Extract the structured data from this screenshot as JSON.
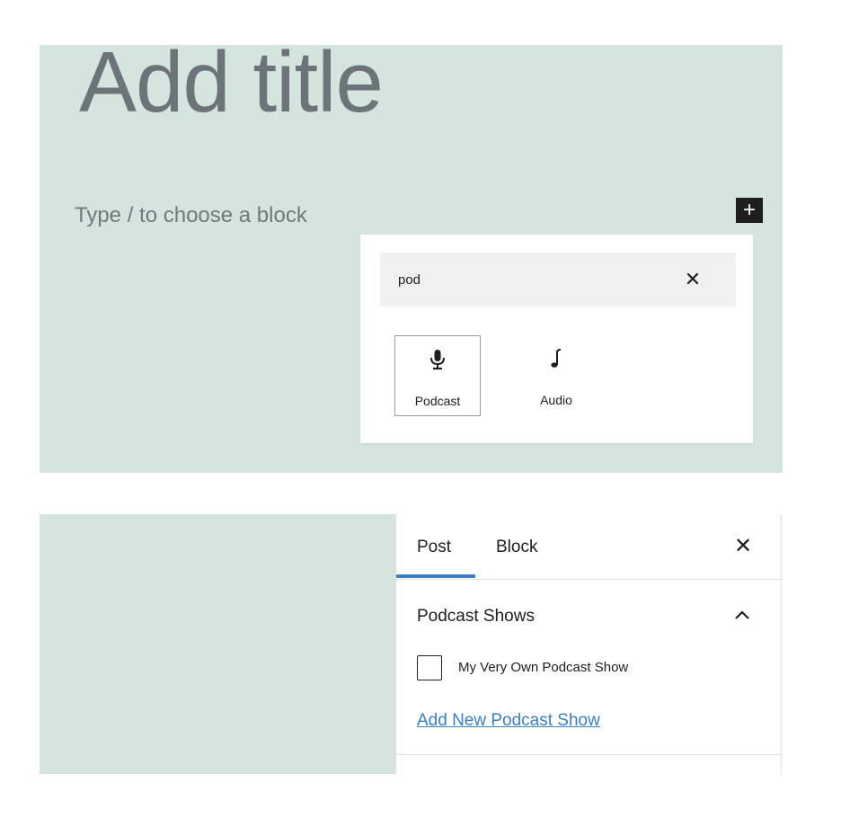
{
  "editor": {
    "title_placeholder": "Add title",
    "block_placeholder": "Type / to choose a block",
    "add_block_icon": "plus-icon"
  },
  "inserter": {
    "search_value": "pod",
    "clear_icon": "close-icon",
    "results": [
      {
        "label": "Podcast",
        "icon": "microphone-icon",
        "selected": true
      },
      {
        "label": "Audio",
        "icon": "music-note-icon",
        "selected": false
      }
    ]
  },
  "sidebar": {
    "tabs": [
      {
        "label": "Post",
        "active": true
      },
      {
        "label": "Block",
        "active": false
      }
    ],
    "close_icon": "close-icon",
    "panel": {
      "title": "Podcast Shows",
      "toggle_icon": "chevron-up-icon",
      "options": [
        {
          "label": "My Very Own Podcast Show",
          "checked": false
        }
      ],
      "add_new_link": "Add New Podcast Show"
    }
  },
  "colors": {
    "canvas_background": "#d4e4de",
    "accent": "#3a7fc1",
    "text": "#1e1e1e",
    "placeholder_text": "#6c7479"
  }
}
